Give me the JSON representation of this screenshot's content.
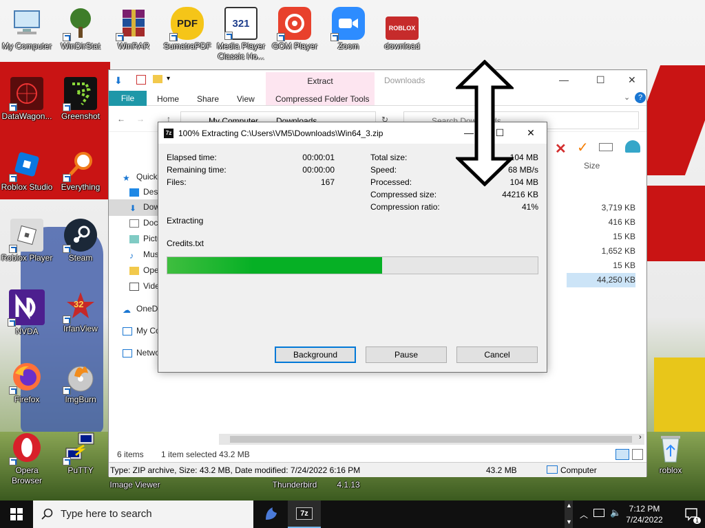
{
  "desktop": {
    "icons": [
      {
        "label": "My Computer"
      },
      {
        "label": "WinDirStat"
      },
      {
        "label": "WinRAR"
      },
      {
        "label": "SumatraPDF"
      },
      {
        "label": "Media Player Classic Ho..."
      },
      {
        "label": "GOM Player"
      },
      {
        "label": "Zoom"
      },
      {
        "label": "download"
      },
      {
        "label": "DataWagon..."
      },
      {
        "label": "Greenshot"
      },
      {
        "label": "Roblox Studio"
      },
      {
        "label": "Everything"
      },
      {
        "label": "Roblox Player"
      },
      {
        "label": "Steam"
      },
      {
        "label": "NVDA"
      },
      {
        "label": "IrfanView"
      },
      {
        "label": "Firefox"
      },
      {
        "label": "ImgBurn"
      },
      {
        "label": "Opera Browser"
      },
      {
        "label": "PuTTY"
      },
      {
        "label": "roblox"
      }
    ],
    "partial_labels": [
      "Image Viewer",
      "Thunderbird",
      "4.1.13"
    ],
    "roblox_logo_text": "ROBLOX",
    "pdf_logo_text": "PDF",
    "mpc_logo_text": "321",
    "irfanview_badge": "32"
  },
  "explorer": {
    "ribbon": {
      "file": "File",
      "home": "Home",
      "share": "Share",
      "view": "View",
      "context_group": "Extract",
      "context_tab": "Compressed Folder Tools"
    },
    "title": "Downloads",
    "breadcrumb": [
      "My Computer",
      "Downloads"
    ],
    "search_placeholder": "Search Downloads",
    "nav": [
      "Quick access",
      "Desktop",
      "Downloads",
      "Documents",
      "Pictures",
      "Music",
      "Open...",
      "Videos",
      "OneDrive",
      "My Computer",
      "Network"
    ],
    "size_header": "Size",
    "sizes": [
      "3,719 KB",
      "416 KB",
      "15 KB",
      "1,652 KB",
      "15 KB",
      "44,250 KB"
    ],
    "status": {
      "items": "6 items",
      "selected": "1 item selected  43.2 MB"
    },
    "info_bar": {
      "details": "Type: ZIP archive, Size: 43.2 MB, Date modified: 7/24/2022 6:16 PM",
      "size": "43.2 MB",
      "location": "Computer"
    }
  },
  "dialog": {
    "title": "100% Extracting C:\\Users\\VM5\\Downloads\\Win64_3.zip",
    "app_icon": "7z",
    "left_stats": [
      {
        "label": "Elapsed time:",
        "value": "00:00:01"
      },
      {
        "label": "Remaining time:",
        "value": "00:00:00"
      },
      {
        "label": "Files:",
        "value": "167"
      }
    ],
    "right_stats": [
      {
        "label": "Total size:",
        "value": "104 MB"
      },
      {
        "label": "Speed:",
        "value": "68 MB/s"
      },
      {
        "label": "Processed:",
        "value": "104 MB"
      },
      {
        "label": "Compressed size:",
        "value": "44216 KB"
      },
      {
        "label": "Compression ratio:",
        "value": "41%"
      }
    ],
    "status": "Extracting",
    "current_file": "Credits.txt",
    "progress_fraction": 0.58,
    "buttons": {
      "background": "Background",
      "pause": "Pause",
      "cancel": "Cancel"
    }
  },
  "taskbar": {
    "search_placeholder": "Type here to search",
    "active_app_label": "7z",
    "time": "7:12 PM",
    "date": "7/24/2022",
    "notification_count": "1"
  },
  "colors": {
    "progress": "#06b025",
    "ribbon_file": "#1e97a8",
    "context_band": "#fde5f0",
    "wallpaper_red": "#c91414"
  }
}
